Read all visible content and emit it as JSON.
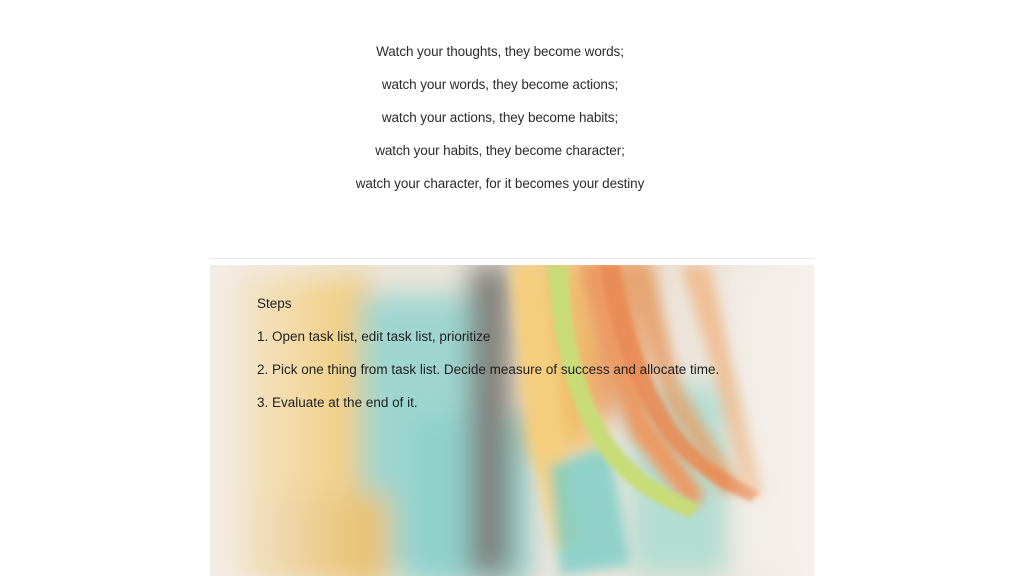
{
  "quote": {
    "lines": [
      "Watch your thoughts, they become words;",
      "watch your words, they become actions;",
      "watch your actions, they become habits;",
      "watch your habits, they become character;",
      "watch your character, for it becomes your destiny"
    ]
  },
  "banner": {
    "image_subject": "blurred colorful sticky notes",
    "colors": [
      "#f5c66b",
      "#8fd1cc",
      "#c9dd7a",
      "#e9925e",
      "#f0dcc4"
    ],
    "steps": {
      "title": "Steps",
      "items": [
        "1. Open task list, edit task list, prioritize",
        "2. Pick one thing from task list. Decide measure of success and allocate time.",
        "3. Evaluate at the end of it."
      ]
    }
  }
}
